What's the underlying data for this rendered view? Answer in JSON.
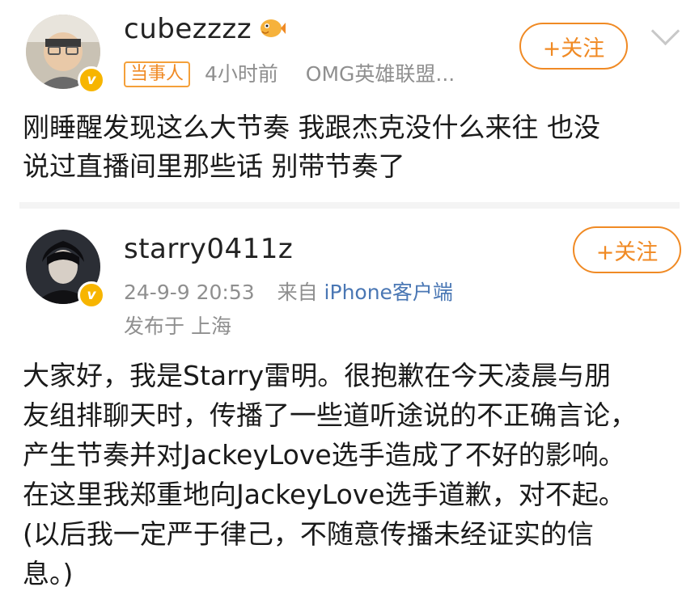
{
  "post1": {
    "username": "cubezzzz",
    "emoji_icon": "pufferfish-icon",
    "tag": "当事人",
    "time": "4小时前",
    "source": "OMG英雄联盟...",
    "follow_label": "+关注",
    "content": "刚睡醒发现这么大节奏 我跟杰克没什么来往 也没\n说过直播间里那些话 别带节奏了"
  },
  "post2": {
    "username": "starry0411z",
    "time": "24-9-9 20:53",
    "from_label": "来自",
    "client": "iPhone客户端",
    "location": "发布于 上海",
    "follow_label": "+关注",
    "content": "大家好，我是Starry雷明。很抱歉在今天凌晨与朋\n友组排聊天时，传播了一些道听途说的不正确言论，\n产生节奏并对JackeyLove选手造成了不好的影响。\n在这里我郑重地向JackeyLove选手道歉，对不起。\n(以后我一定严于律己，不随意传播未经证实的信\n息。)"
  },
  "colors": {
    "accent": "#f08a24",
    "verified_badge": "#f7b500",
    "link": "#4a77b4",
    "meta": "#8f8f8f"
  }
}
